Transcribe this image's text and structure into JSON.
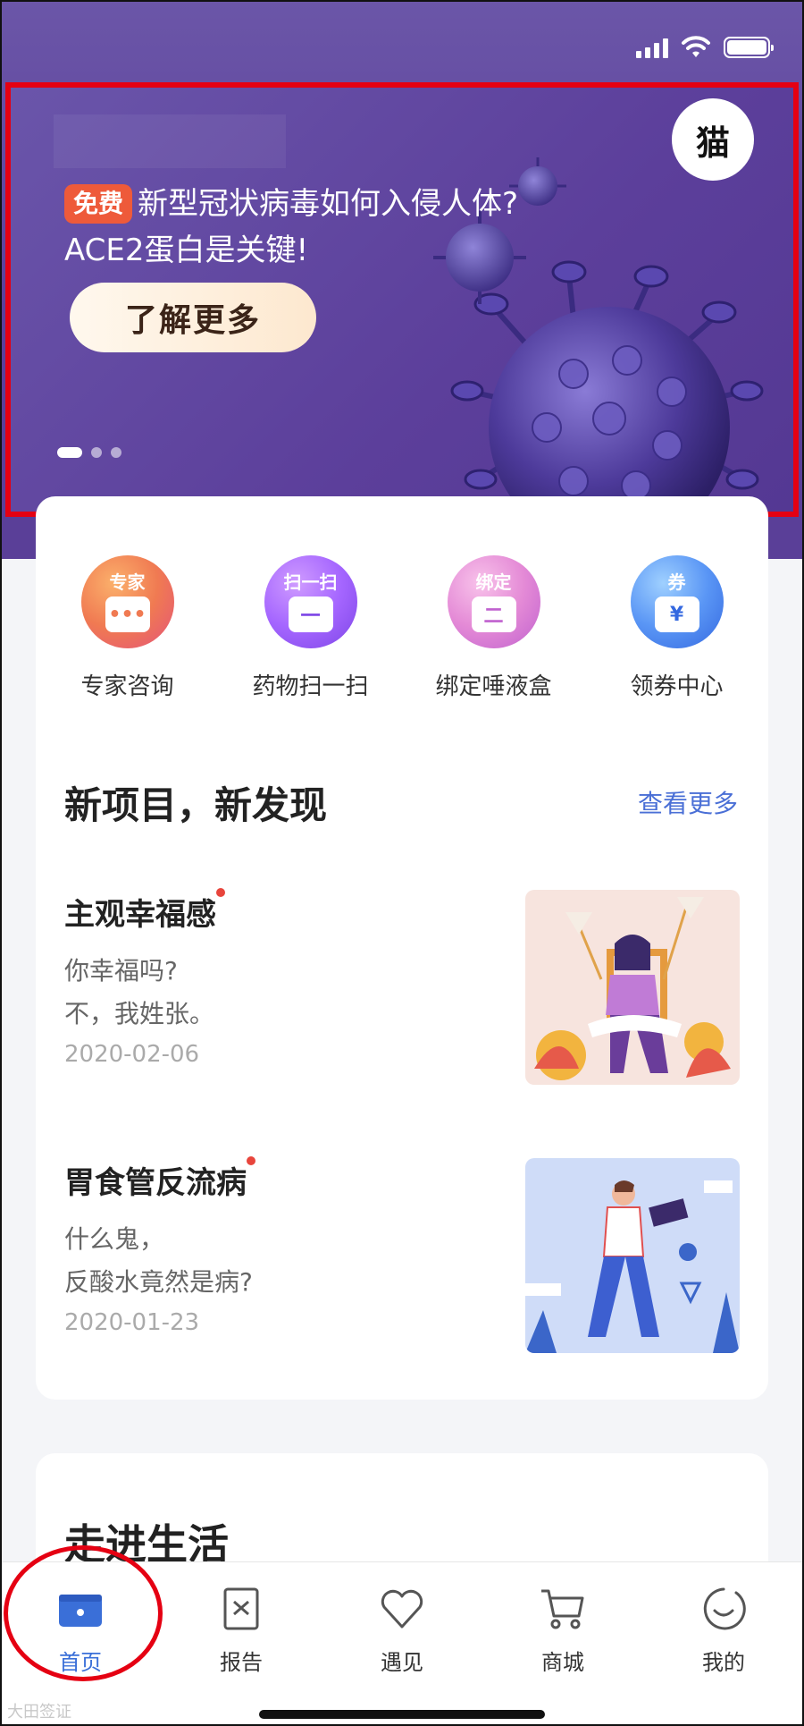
{
  "banner": {
    "badge": "猫",
    "free_tag": "免费",
    "headline_line1": "新型冠状病毒如何入侵人体?",
    "headline_line2": "ACE2蛋白是关键!",
    "cta_label": "了解更多",
    "slides": 3,
    "active_slide": 1
  },
  "quick_actions": [
    {
      "tag": "专家",
      "label": "专家咨询",
      "glyph": "•••",
      "color_a": "#f78e51",
      "color_b": "#e4537a"
    },
    {
      "tag": "扫一扫",
      "label": "药物扫一扫",
      "glyph": "一",
      "color_a": "#b873ff",
      "color_b": "#7d45e6"
    },
    {
      "tag": "绑定",
      "label": "绑定唾液盒",
      "glyph": "二",
      "color_a": "#f3a1d8",
      "color_b": "#c061cf"
    },
    {
      "tag": "券",
      "label": "领券中心",
      "glyph": "¥",
      "color_a": "#6fb4ff",
      "color_b": "#3468e0"
    }
  ],
  "section": {
    "title": "新项目，新发现",
    "see_more": "查看更多"
  },
  "articles": [
    {
      "title": "主观幸福感",
      "line1": "你幸福吗?",
      "line2": "不，我姓张。",
      "date": "2020-02-06"
    },
    {
      "title": "胃食管反流病",
      "line1": "什么鬼，",
      "line2": "反酸水竟然是病?",
      "date": "2020-01-23"
    }
  ],
  "section2": {
    "title": "走进生活"
  },
  "tabs": [
    {
      "label": "首页",
      "icon": "home-icon",
      "active": true
    },
    {
      "label": "报告",
      "icon": "report-icon",
      "active": false
    },
    {
      "label": "遇见",
      "icon": "heart-icon",
      "active": false
    },
    {
      "label": "商城",
      "icon": "cart-icon",
      "active": false
    },
    {
      "label": "我的",
      "icon": "profile-icon",
      "active": false
    }
  ],
  "watermark": "大田签证",
  "colors": {
    "brand_purple": "#5b3f9a",
    "accent_blue": "#3a6fd8",
    "highlight_red": "#e50012"
  }
}
